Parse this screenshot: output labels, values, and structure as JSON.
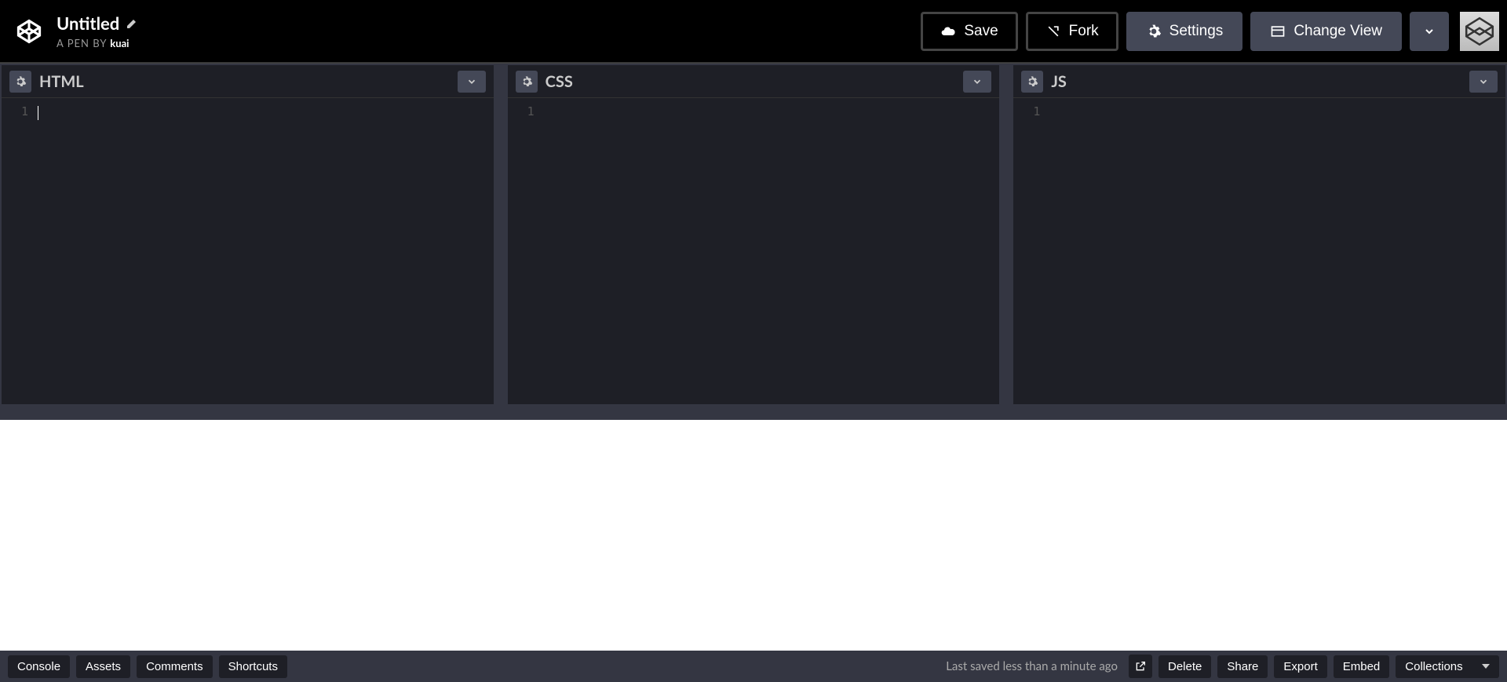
{
  "header": {
    "title": "Untitled",
    "subtitle_prefix": "A PEN BY ",
    "author": "kuai",
    "save_label": "Save",
    "fork_label": "Fork",
    "settings_label": "Settings",
    "change_view_label": "Change View"
  },
  "editors": {
    "html": {
      "label": "HTML",
      "line_number": "1"
    },
    "css": {
      "label": "CSS",
      "line_number": "1"
    },
    "js": {
      "label": "JS",
      "line_number": "1"
    }
  },
  "footer": {
    "console_label": "Console",
    "assets_label": "Assets",
    "comments_label": "Comments",
    "shortcuts_label": "Shortcuts",
    "last_saved": "Last saved less than a minute ago",
    "delete_label": "Delete",
    "share_label": "Share",
    "export_label": "Export",
    "embed_label": "Embed",
    "collections_label": "Collections"
  }
}
